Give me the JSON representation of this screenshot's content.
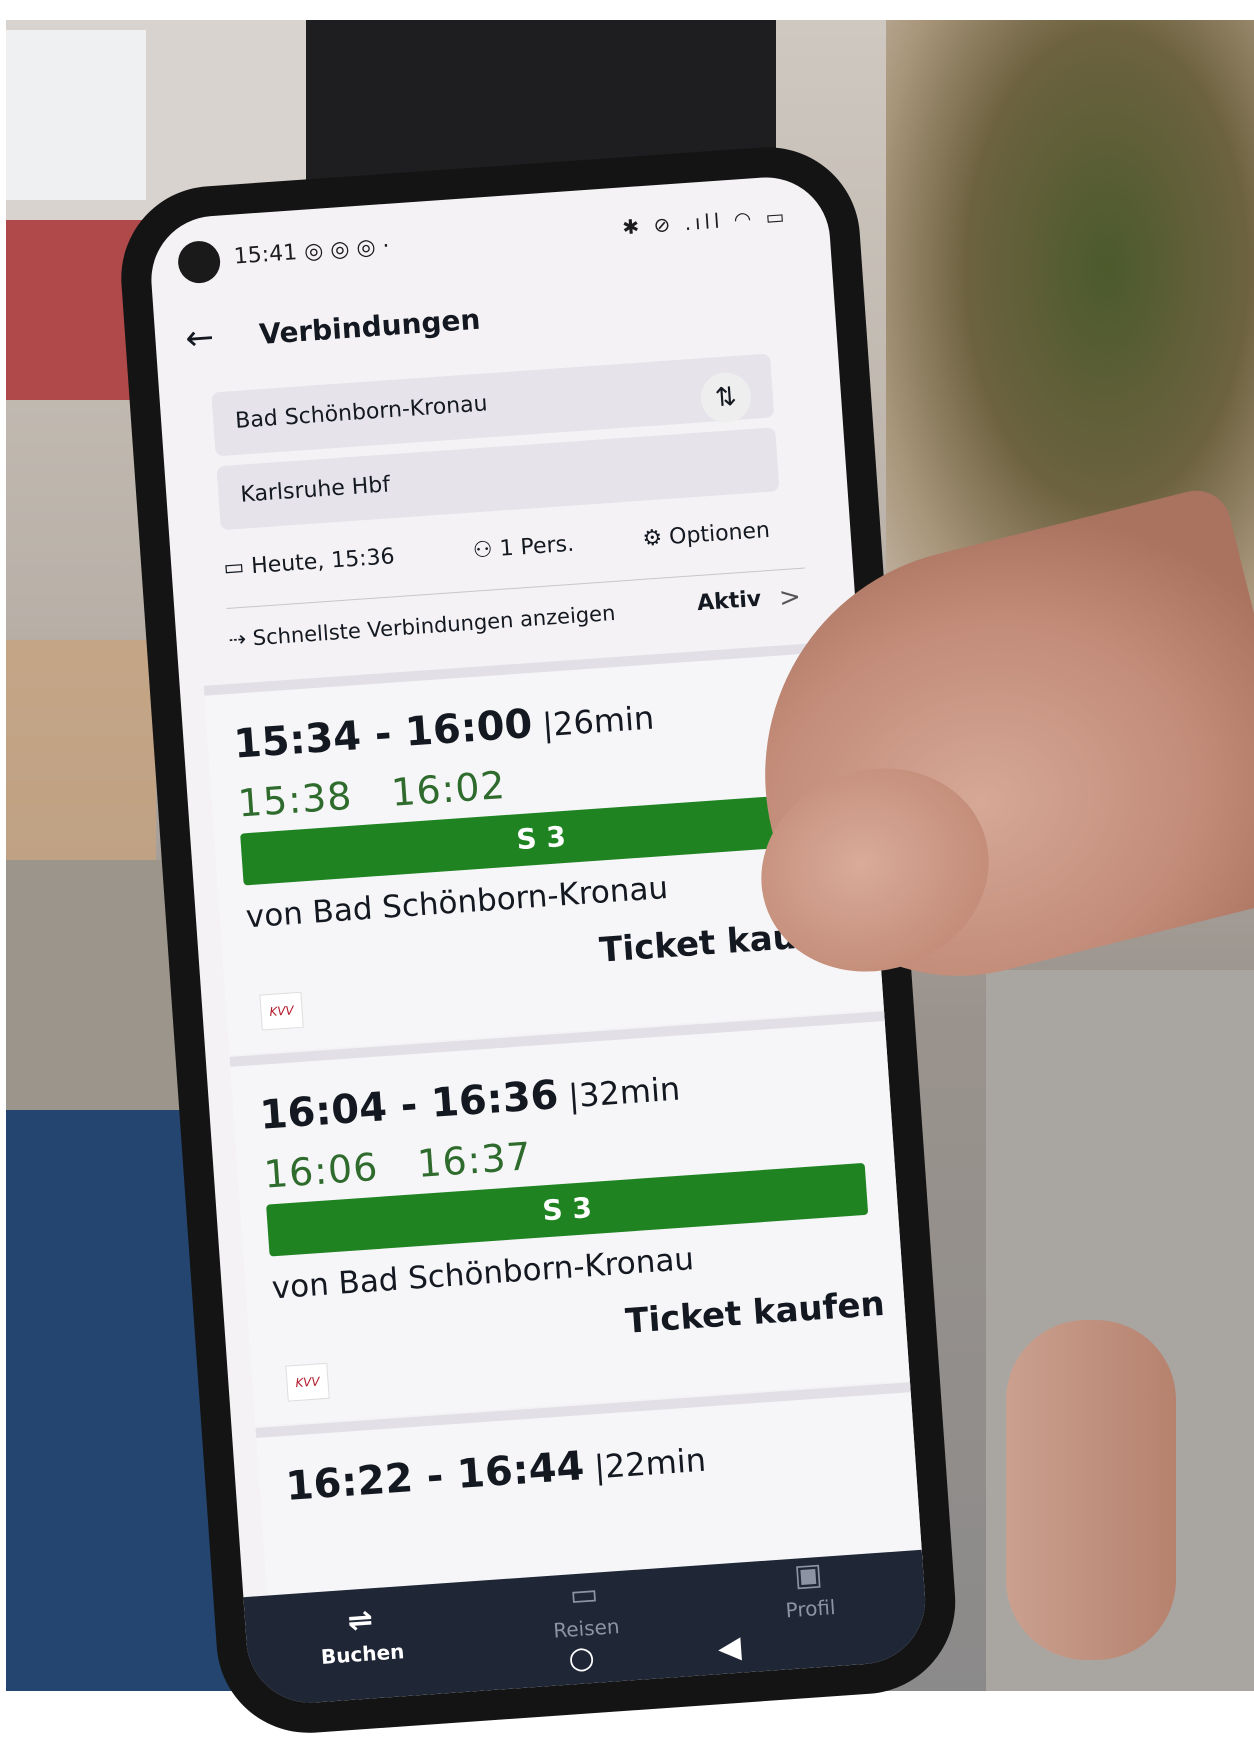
{
  "status_bar": {
    "time": "15:41",
    "icons_left": "◎ ◎ ◎ ·",
    "icons_right": "✱ ⊘ .ıll ◠ ▭"
  },
  "header": {
    "back_icon": "←",
    "title": "Verbindungen"
  },
  "search": {
    "from": "Bad Schönborn-Kronau",
    "to": "Karlsruhe Hbf",
    "swap_icon": "⇅"
  },
  "options": {
    "date_icon": "▭",
    "date": "Heute, 15:36",
    "persons_icon": "⚇",
    "persons": "1 Pers.",
    "options_icon": "⚙",
    "options_label": "Optionen"
  },
  "fastest": {
    "icon": "⇢",
    "label": "Schnellste Verbindungen anzeigen",
    "state": "Aktiv",
    "chevron": ">"
  },
  "connections": [
    {
      "times": "15:34 - 16:00",
      "duration": "|26min",
      "realtime_departure": "15:38",
      "realtime_arrival": "16:02",
      "line": "S 3",
      "from_text": "von Bad Schönborn-Kronau",
      "ticket_label": "Ticket kaufen",
      "operator_logo": "KVV"
    },
    {
      "times": "16:04 - 16:36",
      "duration": "|32min",
      "realtime_departure": "16:06",
      "realtime_arrival": "16:37",
      "line": "S 3",
      "from_text": "von Bad Schönborn-Kronau",
      "ticket_label": "Ticket kaufen",
      "operator_logo": "KVV"
    },
    {
      "times": "16:22 - 16:44",
      "duration": "|22min"
    }
  ],
  "tabbar": {
    "items": [
      {
        "label": "Buchen",
        "icon": "⇌"
      },
      {
        "label": "Reisen",
        "icon": "▭"
      },
      {
        "label": "Profil",
        "icon": "▣"
      }
    ]
  },
  "nav": {
    "home": "○",
    "back": "◀"
  },
  "colors": {
    "line_green": "#1f8322",
    "realtime_green": "#2e6b2c",
    "tabbar": "#1f2636"
  }
}
